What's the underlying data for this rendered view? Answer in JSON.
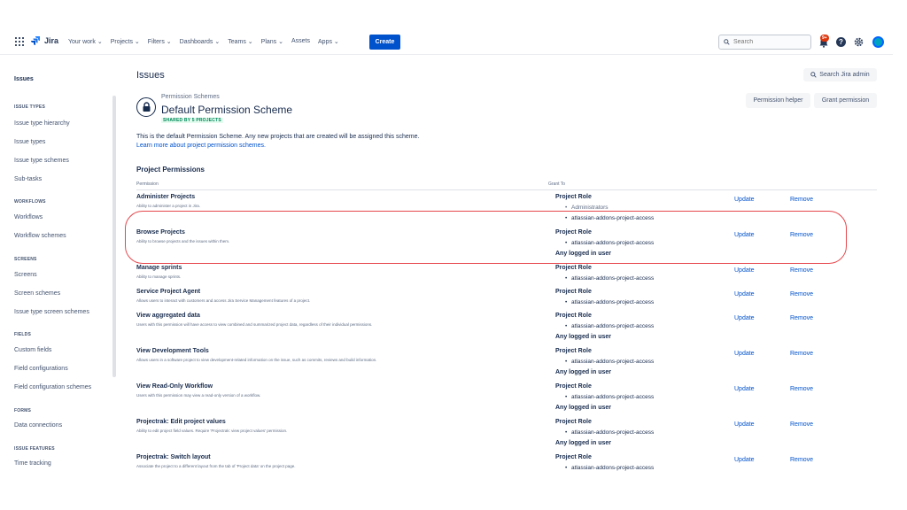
{
  "nav": {
    "logo_text": "Jira",
    "items": [
      "Your work ⌄",
      "Projects ⌄",
      "Filters ⌄",
      "Dashboards ⌄",
      "Teams ⌄",
      "Plans ⌄",
      "Assets",
      "Apps ⌄"
    ],
    "create_label": "Create",
    "search_placeholder": "Search",
    "notif_count": "9+",
    "help_glyph": "?"
  },
  "sidebar": {
    "title": "Issues",
    "sections": [
      {
        "heading": "ISSUE TYPES",
        "items": [
          "Issue type hierarchy",
          "Issue types",
          "Issue type schemes",
          "Sub-tasks"
        ]
      },
      {
        "heading": "WORKFLOWS",
        "items": [
          "Workflows",
          "Workflow schemes"
        ]
      },
      {
        "heading": "SCREENS",
        "items": [
          "Screens",
          "Screen schemes",
          "Issue type screen schemes"
        ]
      },
      {
        "heading": "FIELDS",
        "items": [
          "Custom fields",
          "Field configurations",
          "Field configuration schemes"
        ]
      },
      {
        "heading": "FORMS",
        "items": [
          "Data connections"
        ]
      },
      {
        "heading": "ISSUE FEATURES",
        "items": [
          "Time tracking"
        ]
      }
    ]
  },
  "main": {
    "title": "Issues",
    "search_admin_label": "Search Jira admin",
    "scheme_sup": "Permission Schemes",
    "scheme_title": "Default Permission Scheme",
    "shared_badge": "SHARED BY 5 PROJECTS",
    "permission_helper_label": "Permission helper",
    "grant_permission_label": "Grant permission",
    "description": "This is the default Permission Scheme. Any new projects that are created will be assigned this scheme.",
    "learn_more": "Learn more about project permission schemes.",
    "section_title": "Project Permissions",
    "col_permission": "Permission",
    "col_grant_to": "Grant To",
    "update_label": "Update",
    "remove_label": "Remove"
  },
  "permissions": [
    {
      "name": "Administer Projects",
      "desc": "Ability to administer a project in Jira.",
      "grants": [
        {
          "t": "role",
          "v": "Project Role"
        },
        {
          "t": "strike",
          "v": "Administrators"
        },
        {
          "t": "bullet",
          "v": "atlassian-addons-project-access"
        }
      ]
    },
    {
      "name": "Browse Projects",
      "desc": "Ability to browse projects and the issues within them.",
      "grants": [
        {
          "t": "role",
          "v": "Project Role"
        },
        {
          "t": "bullet",
          "v": "atlassian-addons-project-access"
        },
        {
          "t": "any",
          "v": "Any logged in user"
        }
      ]
    },
    {
      "name": "Manage sprints",
      "desc": "Ability to manage sprints.",
      "grants": [
        {
          "t": "role",
          "v": "Project Role"
        },
        {
          "t": "bullet",
          "v": "atlassian-addons-project-access"
        }
      ]
    },
    {
      "name": "Service Project Agent",
      "desc": "Allows users to interact with customers and access Jira Service Management features of a project.",
      "grants": [
        {
          "t": "role",
          "v": "Project Role"
        },
        {
          "t": "bullet",
          "v": "atlassian-addons-project-access"
        }
      ]
    },
    {
      "name": "View aggregated data",
      "desc": "Users with this permission will have access to view combined and summarized project data, regardless of their individual permissions.",
      "grants": [
        {
          "t": "role",
          "v": "Project Role"
        },
        {
          "t": "bullet",
          "v": "atlassian-addons-project-access"
        },
        {
          "t": "any",
          "v": "Any logged in user"
        }
      ]
    },
    {
      "name": "View Development Tools",
      "desc": "Allows users in a software project to view development-related information on the issue, such as commits, reviews and build information.",
      "grants": [
        {
          "t": "role",
          "v": "Project Role"
        },
        {
          "t": "bullet",
          "v": "atlassian-addons-project-access"
        },
        {
          "t": "any",
          "v": "Any logged in user"
        }
      ]
    },
    {
      "name": "View Read-Only Workflow",
      "desc": "Users with this permission may view a read-only version of a workflow.",
      "grants": [
        {
          "t": "role",
          "v": "Project Role"
        },
        {
          "t": "bullet",
          "v": "atlassian-addons-project-access"
        },
        {
          "t": "any",
          "v": "Any logged in user"
        }
      ]
    },
    {
      "name": "Projectrak: Edit project values",
      "desc": "Ability to edit project field values. Require 'Projectrak: view project values' permission.",
      "grants": [
        {
          "t": "role",
          "v": "Project Role"
        },
        {
          "t": "bullet",
          "v": "atlassian-addons-project-access"
        },
        {
          "t": "any",
          "v": "Any logged in user"
        }
      ]
    },
    {
      "name": "Projectrak: Switch layout",
      "desc": "Associate the project to a different layout from the tab of 'Project data' on the project page.",
      "grants": [
        {
          "t": "role",
          "v": "Project Role"
        },
        {
          "t": "bullet",
          "v": "atlassian-addons-project-access"
        }
      ]
    }
  ],
  "colors": {
    "accent": "#0052cc",
    "highlight": "#e5484d",
    "badge_green": "#00875a"
  }
}
